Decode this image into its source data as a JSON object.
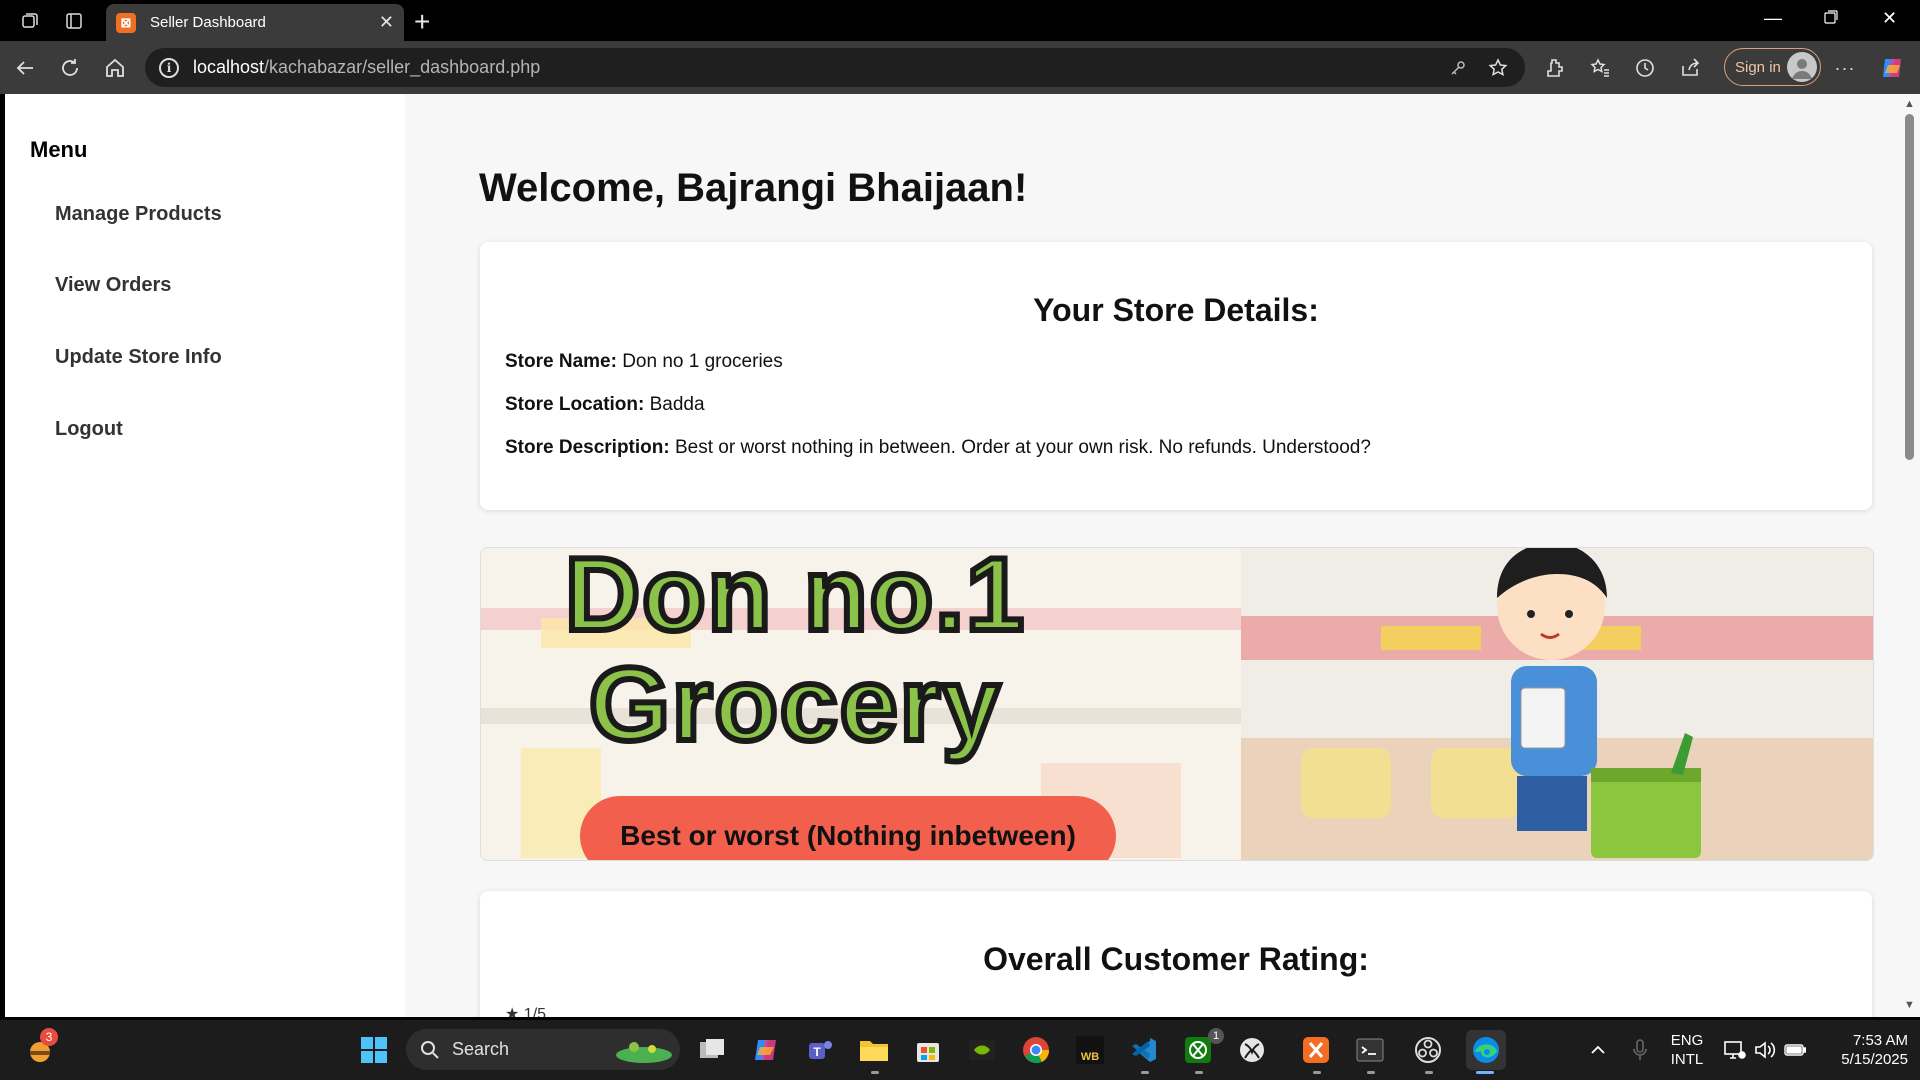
{
  "browser": {
    "tab_title": "Seller Dashboard",
    "tab_favicon": "XAMPP",
    "url_host": "localhost",
    "url_path": "/kachabazar/seller_dashboard.php",
    "signin_label": "Sign in"
  },
  "sidebar": {
    "title": "Menu",
    "items": [
      {
        "label": "Manage Products"
      },
      {
        "label": "View Orders"
      },
      {
        "label": "Update Store Info"
      },
      {
        "label": "Logout"
      }
    ]
  },
  "main": {
    "welcome": "Welcome, Bajrangi Bhaijaan!",
    "store_card": {
      "title": "Your Store Details:",
      "name_label": "Store Name:",
      "name_value": "Don no 1 groceries",
      "location_label": "Store Location:",
      "location_value": "Badda",
      "description_label": "Store Description:",
      "description_value": "Best or worst nothing in between. Order at your own risk. No refunds. Understood?"
    },
    "banner": {
      "line1": "Don no.1",
      "line2": "Grocery",
      "tagline": "Best or worst (Nothing inbetween)"
    },
    "rating_card": {
      "title": "Overall Customer Rating:",
      "value_partial": "1/5"
    }
  },
  "taskbar": {
    "search_label": "Search",
    "weather_badge": "3",
    "xbox_badge": "1",
    "language": "ENG",
    "layout": "INTL",
    "time": "7:53 AM",
    "date": "5/15/2025",
    "wb_label": "WB"
  },
  "colors": {
    "accent_green": "#8bc34a",
    "tagline_red": "#f25f4c",
    "chrome_dark": "#3b3b3b"
  }
}
